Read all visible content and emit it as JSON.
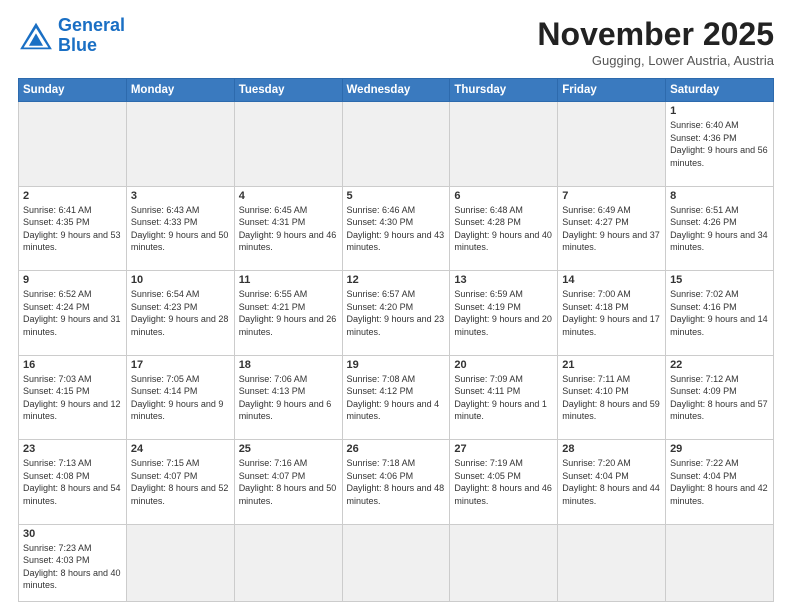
{
  "header": {
    "logo_general": "General",
    "logo_blue": "Blue",
    "month_title": "November 2025",
    "subtitle": "Gugging, Lower Austria, Austria"
  },
  "weekdays": [
    "Sunday",
    "Monday",
    "Tuesday",
    "Wednesday",
    "Thursday",
    "Friday",
    "Saturday"
  ],
  "weeks": [
    [
      {
        "day": "",
        "empty": true
      },
      {
        "day": "",
        "empty": true
      },
      {
        "day": "",
        "empty": true
      },
      {
        "day": "",
        "empty": true
      },
      {
        "day": "",
        "empty": true
      },
      {
        "day": "",
        "empty": true
      },
      {
        "day": "1",
        "sunrise": "6:40 AM",
        "sunset": "4:36 PM",
        "daylight": "9 hours and 56 minutes."
      }
    ],
    [
      {
        "day": "2",
        "sunrise": "6:41 AM",
        "sunset": "4:35 PM",
        "daylight": "9 hours and 53 minutes."
      },
      {
        "day": "3",
        "sunrise": "6:43 AM",
        "sunset": "4:33 PM",
        "daylight": "9 hours and 50 minutes."
      },
      {
        "day": "4",
        "sunrise": "6:45 AM",
        "sunset": "4:31 PM",
        "daylight": "9 hours and 46 minutes."
      },
      {
        "day": "5",
        "sunrise": "6:46 AM",
        "sunset": "4:30 PM",
        "daylight": "9 hours and 43 minutes."
      },
      {
        "day": "6",
        "sunrise": "6:48 AM",
        "sunset": "4:28 PM",
        "daylight": "9 hours and 40 minutes."
      },
      {
        "day": "7",
        "sunrise": "6:49 AM",
        "sunset": "4:27 PM",
        "daylight": "9 hours and 37 minutes."
      },
      {
        "day": "8",
        "sunrise": "6:51 AM",
        "sunset": "4:26 PM",
        "daylight": "9 hours and 34 minutes."
      }
    ],
    [
      {
        "day": "9",
        "sunrise": "6:52 AM",
        "sunset": "4:24 PM",
        "daylight": "9 hours and 31 minutes."
      },
      {
        "day": "10",
        "sunrise": "6:54 AM",
        "sunset": "4:23 PM",
        "daylight": "9 hours and 28 minutes."
      },
      {
        "day": "11",
        "sunrise": "6:55 AM",
        "sunset": "4:21 PM",
        "daylight": "9 hours and 26 minutes."
      },
      {
        "day": "12",
        "sunrise": "6:57 AM",
        "sunset": "4:20 PM",
        "daylight": "9 hours and 23 minutes."
      },
      {
        "day": "13",
        "sunrise": "6:59 AM",
        "sunset": "4:19 PM",
        "daylight": "9 hours and 20 minutes."
      },
      {
        "day": "14",
        "sunrise": "7:00 AM",
        "sunset": "4:18 PM",
        "daylight": "9 hours and 17 minutes."
      },
      {
        "day": "15",
        "sunrise": "7:02 AM",
        "sunset": "4:16 PM",
        "daylight": "9 hours and 14 minutes."
      }
    ],
    [
      {
        "day": "16",
        "sunrise": "7:03 AM",
        "sunset": "4:15 PM",
        "daylight": "9 hours and 12 minutes."
      },
      {
        "day": "17",
        "sunrise": "7:05 AM",
        "sunset": "4:14 PM",
        "daylight": "9 hours and 9 minutes."
      },
      {
        "day": "18",
        "sunrise": "7:06 AM",
        "sunset": "4:13 PM",
        "daylight": "9 hours and 6 minutes."
      },
      {
        "day": "19",
        "sunrise": "7:08 AM",
        "sunset": "4:12 PM",
        "daylight": "9 hours and 4 minutes."
      },
      {
        "day": "20",
        "sunrise": "7:09 AM",
        "sunset": "4:11 PM",
        "daylight": "9 hours and 1 minute."
      },
      {
        "day": "21",
        "sunrise": "7:11 AM",
        "sunset": "4:10 PM",
        "daylight": "8 hours and 59 minutes."
      },
      {
        "day": "22",
        "sunrise": "7:12 AM",
        "sunset": "4:09 PM",
        "daylight": "8 hours and 57 minutes."
      }
    ],
    [
      {
        "day": "23",
        "sunrise": "7:13 AM",
        "sunset": "4:08 PM",
        "daylight": "8 hours and 54 minutes."
      },
      {
        "day": "24",
        "sunrise": "7:15 AM",
        "sunset": "4:07 PM",
        "daylight": "8 hours and 52 minutes."
      },
      {
        "day": "25",
        "sunrise": "7:16 AM",
        "sunset": "4:07 PM",
        "daylight": "8 hours and 50 minutes."
      },
      {
        "day": "26",
        "sunrise": "7:18 AM",
        "sunset": "4:06 PM",
        "daylight": "8 hours and 48 minutes."
      },
      {
        "day": "27",
        "sunrise": "7:19 AM",
        "sunset": "4:05 PM",
        "daylight": "8 hours and 46 minutes."
      },
      {
        "day": "28",
        "sunrise": "7:20 AM",
        "sunset": "4:04 PM",
        "daylight": "8 hours and 44 minutes."
      },
      {
        "day": "29",
        "sunrise": "7:22 AM",
        "sunset": "4:04 PM",
        "daylight": "8 hours and 42 minutes."
      }
    ],
    [
      {
        "day": "30",
        "sunrise": "7:23 AM",
        "sunset": "4:03 PM",
        "daylight": "8 hours and 40 minutes.",
        "last": true
      },
      {
        "day": "",
        "empty": true,
        "last": true
      },
      {
        "day": "",
        "empty": true,
        "last": true
      },
      {
        "day": "",
        "empty": true,
        "last": true
      },
      {
        "day": "",
        "empty": true,
        "last": true
      },
      {
        "day": "",
        "empty": true,
        "last": true
      },
      {
        "day": "",
        "empty": true,
        "last": true
      }
    ]
  ]
}
